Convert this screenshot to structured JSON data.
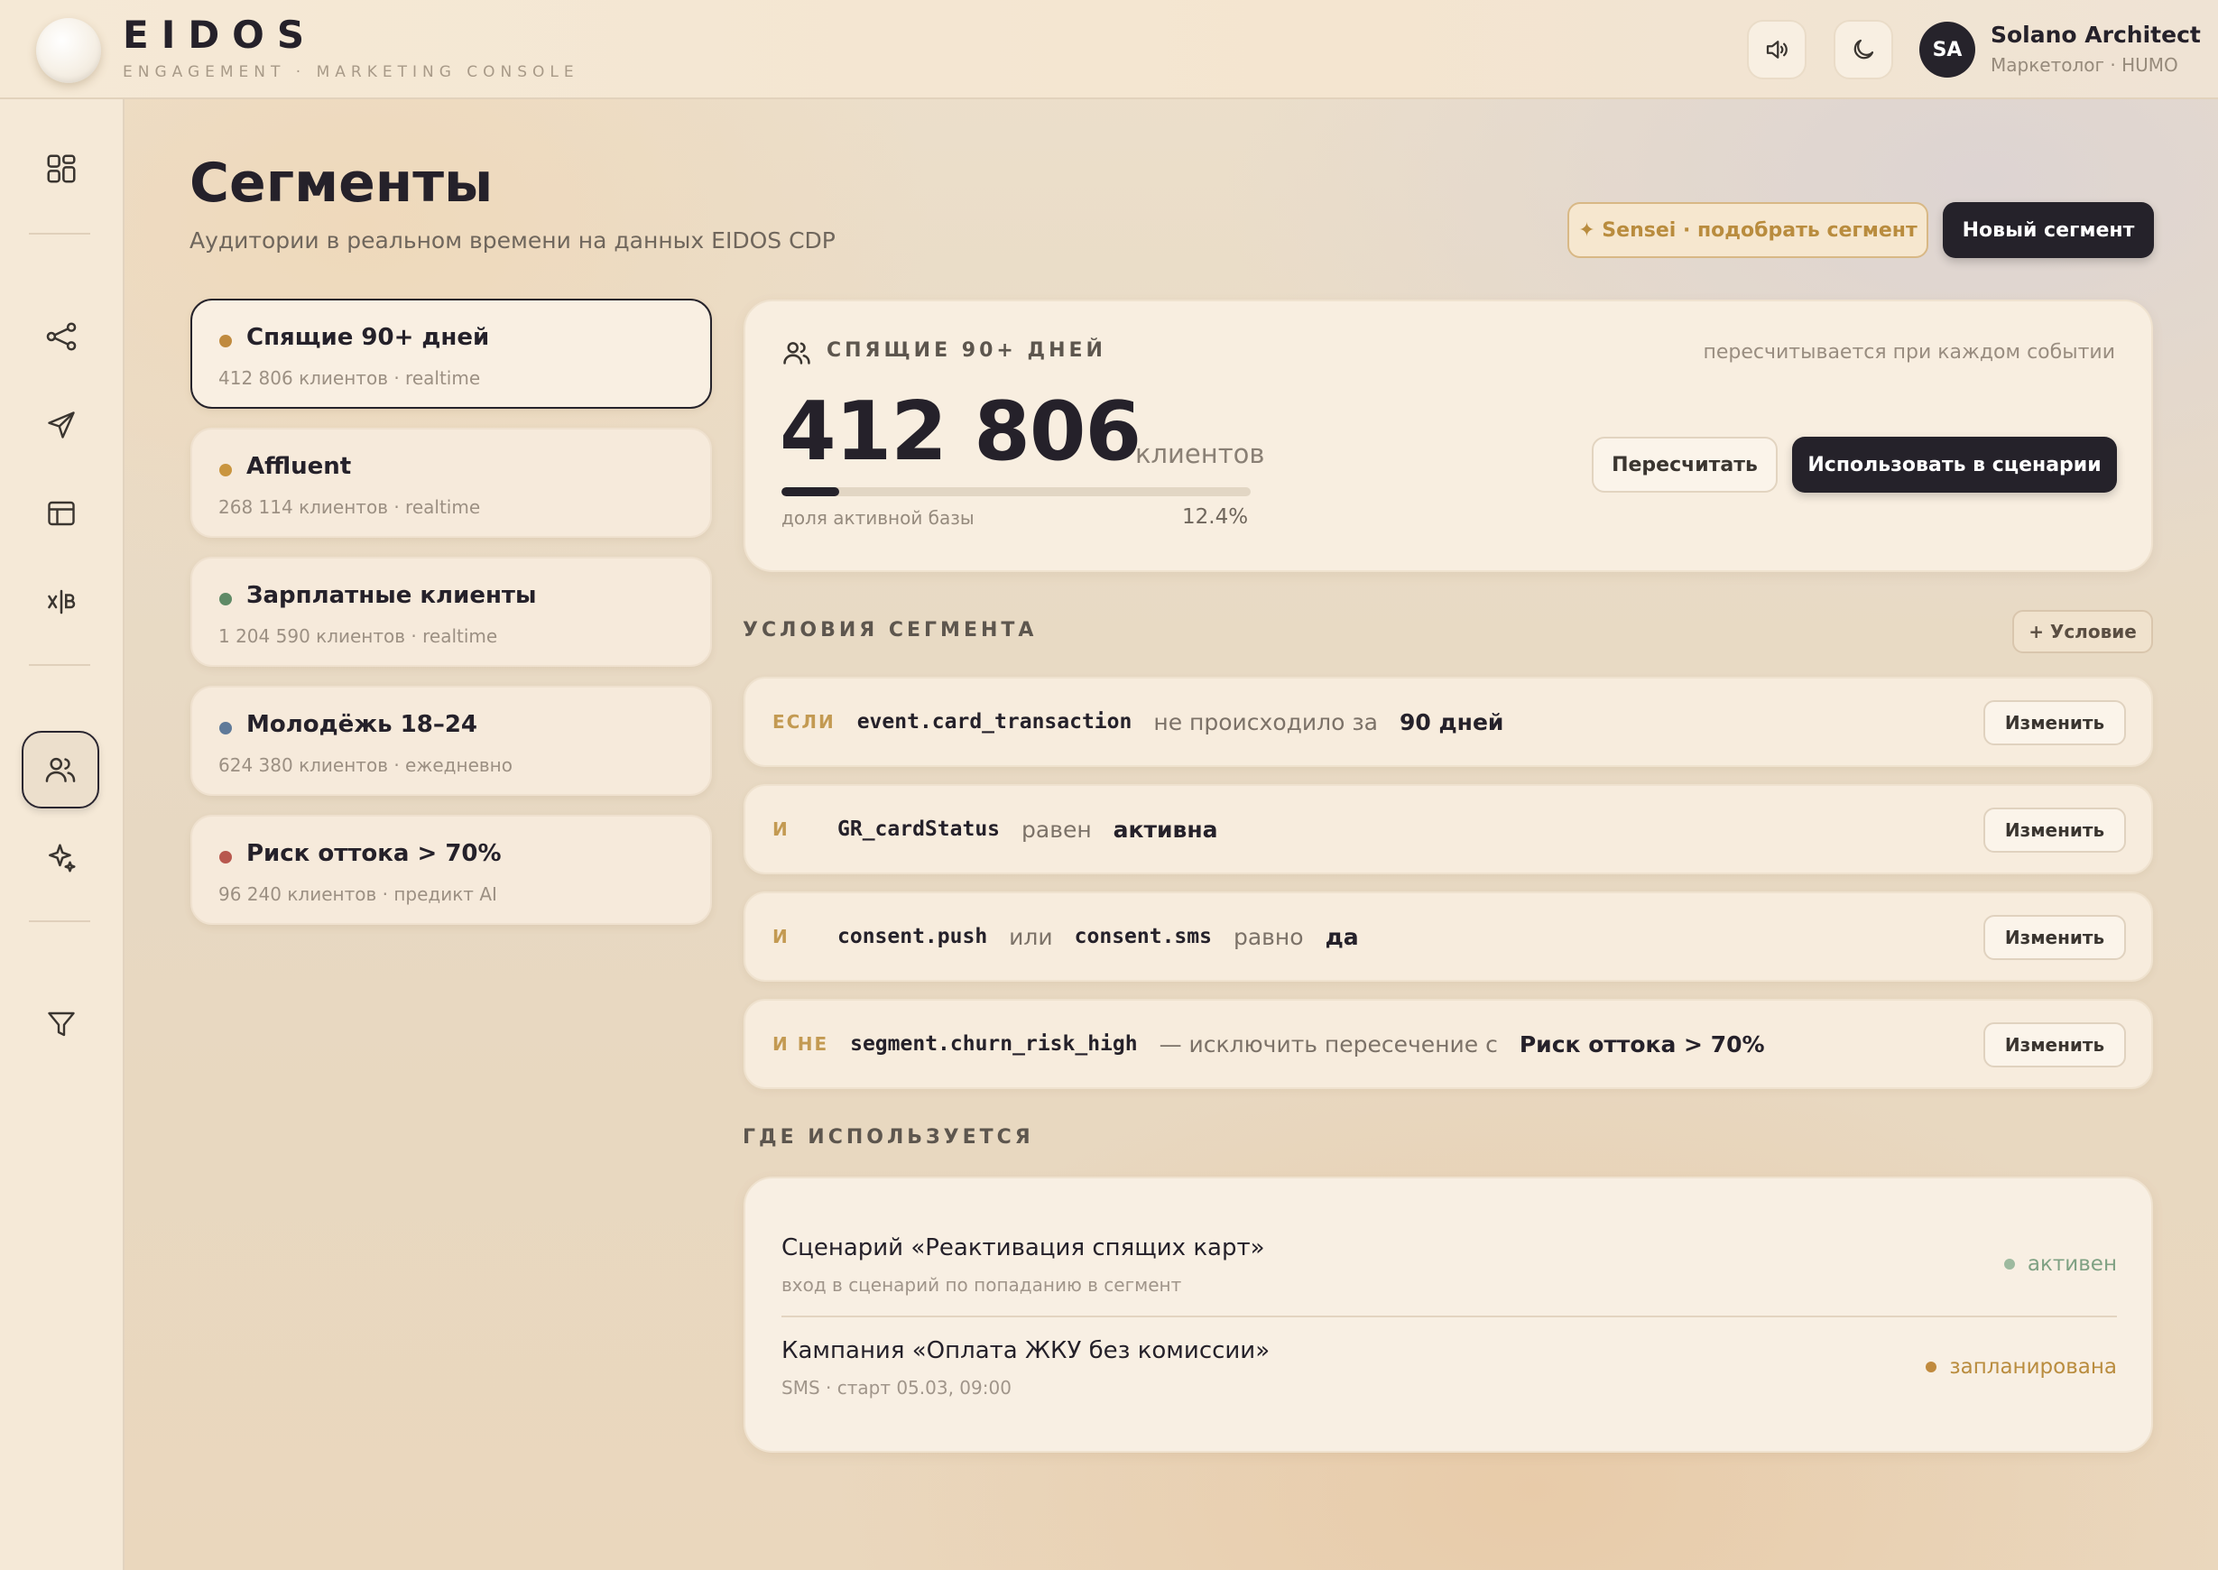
{
  "header": {
    "brand": "EIDOS",
    "subtitle": "ENGAGEMENT · MARKETING CONSOLE",
    "user_initials": "SA",
    "user_name": "Solano Architect",
    "user_role": "Маркетолог · HUMO",
    "icons": [
      "sound-icon",
      "moon-icon"
    ]
  },
  "sidebar": {
    "icons": [
      "dashboard-icon",
      "flow-icon",
      "send-icon",
      "layout-icon",
      "ab-test-icon",
      "users-icon",
      "sparkle-icon",
      "filter-icon"
    ],
    "active": "users-icon"
  },
  "page": {
    "title": "Сегменты",
    "subtitle": "Аудитории в реальном времени на данных EIDOS CDP",
    "sensei_button": "✦ Sensei · подобрать сегмент",
    "new_button": "Новый сегмент"
  },
  "segments": [
    {
      "name": "Спящие 90+ дней",
      "meta": "412 806 клиентов · realtime",
      "color": "#c08a3e",
      "selected": true
    },
    {
      "name": "Affluent",
      "meta": "268 114 клиентов · realtime",
      "color": "#c9953f",
      "selected": false
    },
    {
      "name": "Зарплатные клиенты",
      "meta": "1 204 590 клиентов · realtime",
      "color": "#5f8a66",
      "selected": false
    },
    {
      "name": "Молодёжь 18–24",
      "meta": "624 380 клиентов · ежедневно",
      "color": "#5f7a99",
      "selected": false
    },
    {
      "name": "Риск оттока > 70%",
      "meta": "96 240 клиентов · предикт AI",
      "color": "#b8584e",
      "selected": false
    }
  ],
  "summary": {
    "label": "СПЯЩИЕ 90+ ДНЕЙ",
    "note": "пересчитывается при каждом событии",
    "count": "412 806",
    "unit": "клиентов",
    "share_label": "доля активной базы",
    "share_value": "12.4%",
    "share_fraction": 0.124,
    "recalc_button": "Пересчитать",
    "use_button": "Использовать в сценарии"
  },
  "conditions": {
    "title": "УСЛОВИЯ СЕГМЕНТА",
    "add_button": "+ Условие",
    "edit_label": "Изменить",
    "rows": [
      {
        "kw": "ЕСЛИ",
        "c1": "event.card_transaction",
        "o1": "не происходило за",
        "v1": "90 дней"
      },
      {
        "kw": "И",
        "c1": "GR_cardStatus",
        "o1": "равен",
        "v1": "активна"
      },
      {
        "kw": "И",
        "c1": "consent.push",
        "o1": "или",
        "c2": "consent.sms",
        "o2": "равно",
        "v2": "да"
      },
      {
        "kw": "И НЕ",
        "c1": "segment.churn_risk_high",
        "o1": "— исключить пересечение с",
        "v1": "Риск оттока > 70%"
      }
    ]
  },
  "usage": {
    "title": "ГДЕ ИСПОЛЬЗУЕТСЯ",
    "items": [
      {
        "name": "Сценарий «Реактивация спящих карт»",
        "desc": "вход в сценарий по попаданию в сегмент",
        "status": "активен",
        "status_color": "#7fa183",
        "dot_color": "#9dba9f"
      },
      {
        "name": "Кампания «Оплата ЖКУ без комиссии»",
        "desc": "SMS · старт 05.03, 09:00",
        "status": "запланирована",
        "status_color": "#b98c3e",
        "dot_color": "#c08a3e"
      }
    ]
  }
}
